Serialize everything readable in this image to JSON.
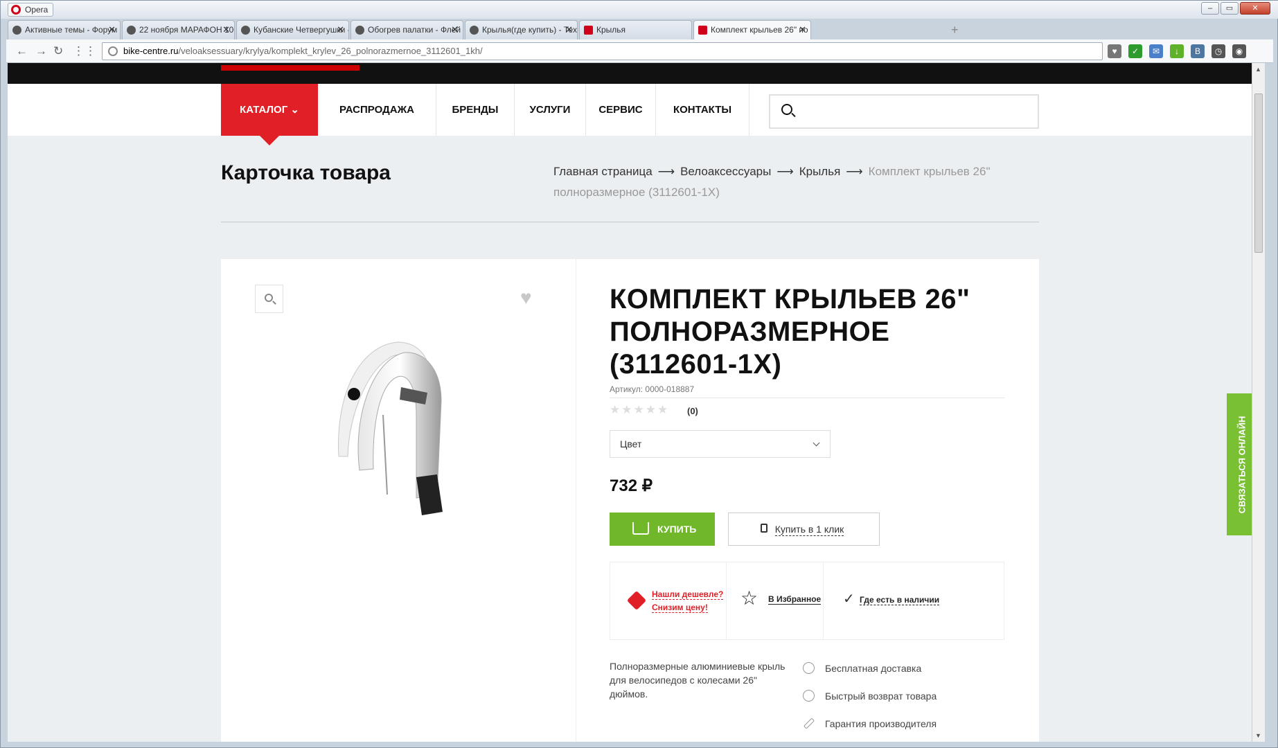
{
  "browser": {
    "app_name": "Opera",
    "tabs": [
      {
        "title": "Активные темы - Форум"
      },
      {
        "title": "22 ноября МАРАФОН 100"
      },
      {
        "title": "Кубанские Четвергушки -"
      },
      {
        "title": "Обогрев палатки - Флей"
      },
      {
        "title": "Крылья(где купить) - Тех"
      },
      {
        "title": "Крылья"
      },
      {
        "title": "Комплект крыльев 26\" по"
      }
    ],
    "url_host": "bike-centre.ru",
    "url_path": "/veloaksessuary/krylya/komplekt_krylev_26_polnorazmernoe_3112601_1kh/",
    "extensions": [
      {
        "name": "heart-icon",
        "glyph": "♥",
        "color": "#777777"
      },
      {
        "name": "shield-icon",
        "glyph": "✓",
        "color": "#2e9b2e"
      },
      {
        "name": "mail-icon",
        "glyph": "✉",
        "color": "#4a7fc9"
      },
      {
        "name": "download-icon",
        "glyph": "↓",
        "color": "#5fb12a"
      },
      {
        "name": "vk-icon",
        "glyph": "В",
        "color": "#4d76a1"
      },
      {
        "name": "clock-icon",
        "glyph": "◷",
        "color": "#555555"
      },
      {
        "name": "account-icon",
        "glyph": "◉",
        "color": "#555555"
      }
    ]
  },
  "site": {
    "menu": [
      {
        "label": "КАТАЛОГ ⌄"
      },
      {
        "label": "РАСПРОДАЖА"
      },
      {
        "label": "БРЕНДЫ"
      },
      {
        "label": "УСЛУГИ"
      },
      {
        "label": "СЕРВИС"
      },
      {
        "label": "КОНТАКТЫ"
      }
    ],
    "search_placeholder": "",
    "page_title": "Карточка товара",
    "breadcrumb": [
      {
        "label": "Главная страница"
      },
      {
        "label": "Велоаксессуары"
      },
      {
        "label": "Крылья"
      },
      {
        "label": "Комплект крыльев 26\" полноразмерное (3112601-1X)"
      }
    ],
    "breadcrumb_sep": "⟶",
    "online_chat": "СВЯЗАТЬСЯ ОНЛАЙН",
    "accent_color": "#e01f26",
    "green_color": "#70b72a"
  },
  "product": {
    "title": "КОМПЛЕКТ КРЫЛЬЕВ 26\" ПОЛНОРАЗМЕРНОЕ (3112601-1X)",
    "article": "Артикул: 0000-018887",
    "rating": 0,
    "reviews_count": "(0)",
    "color_select_label": "Цвет",
    "price": "732 ₽",
    "buy_label": "КУПИТЬ",
    "one_click_label": "Купить в 1 клик",
    "cheaper_line1": "Нашли дешевле?",
    "cheaper_line2": "Снизим цену!",
    "favorites_label": "В Избранное",
    "availability_label": "Где есть в наличии",
    "description": "Полноразмерные алюминиевые крыль для велосипедов с колесами 26\" дюймов.",
    "perks": [
      {
        "label": "Бесплатная доставка",
        "icon": "gear-icon"
      },
      {
        "label": "Быстрый возврат товара",
        "icon": "refresh-icon"
      },
      {
        "label": "Гарантия производителя",
        "icon": "wrench-icon"
      }
    ]
  }
}
